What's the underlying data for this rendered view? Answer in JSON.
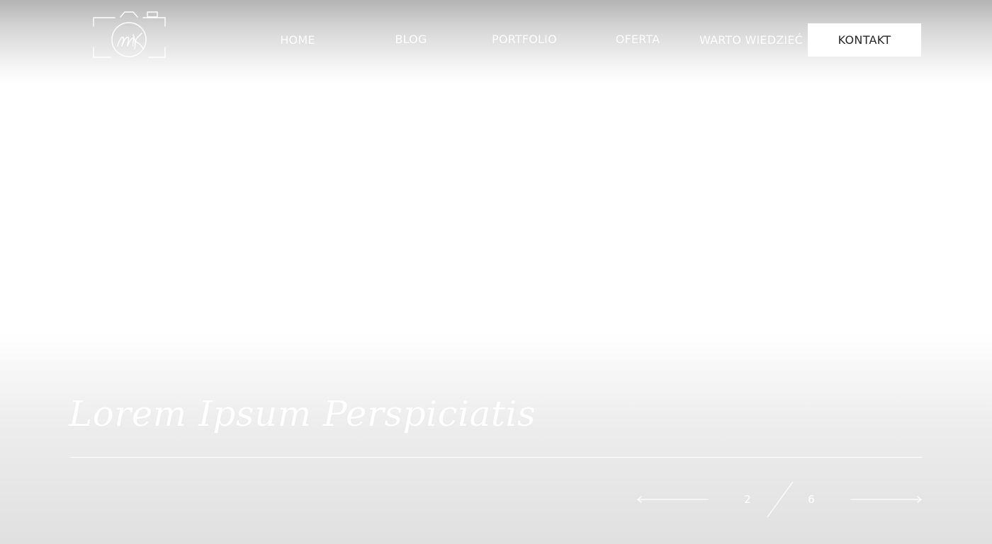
{
  "nav": {
    "items": [
      {
        "label": "HOME"
      },
      {
        "label": "BLOG"
      },
      {
        "label": "PORTFOLIO"
      },
      {
        "label": "OFERTA"
      },
      {
        "label": "WARTO WIEDZIEĆ"
      }
    ],
    "cta_label": "KONTAKT"
  },
  "logo": {
    "icon": "camera-monogram-icon",
    "monogram": "MK"
  },
  "hero": {
    "title": "Lorem Ipsum Perspiciatis"
  },
  "slider": {
    "current": "2",
    "total": "6",
    "prev_icon": "arrow-left-icon",
    "next_icon": "arrow-right-icon"
  },
  "colors": {
    "text_light": "#ffffff",
    "button_bg": "#ffffff",
    "button_text": "#262626",
    "header_shade": "#b4b4b4",
    "footer_shade": "#e0e0e0"
  }
}
